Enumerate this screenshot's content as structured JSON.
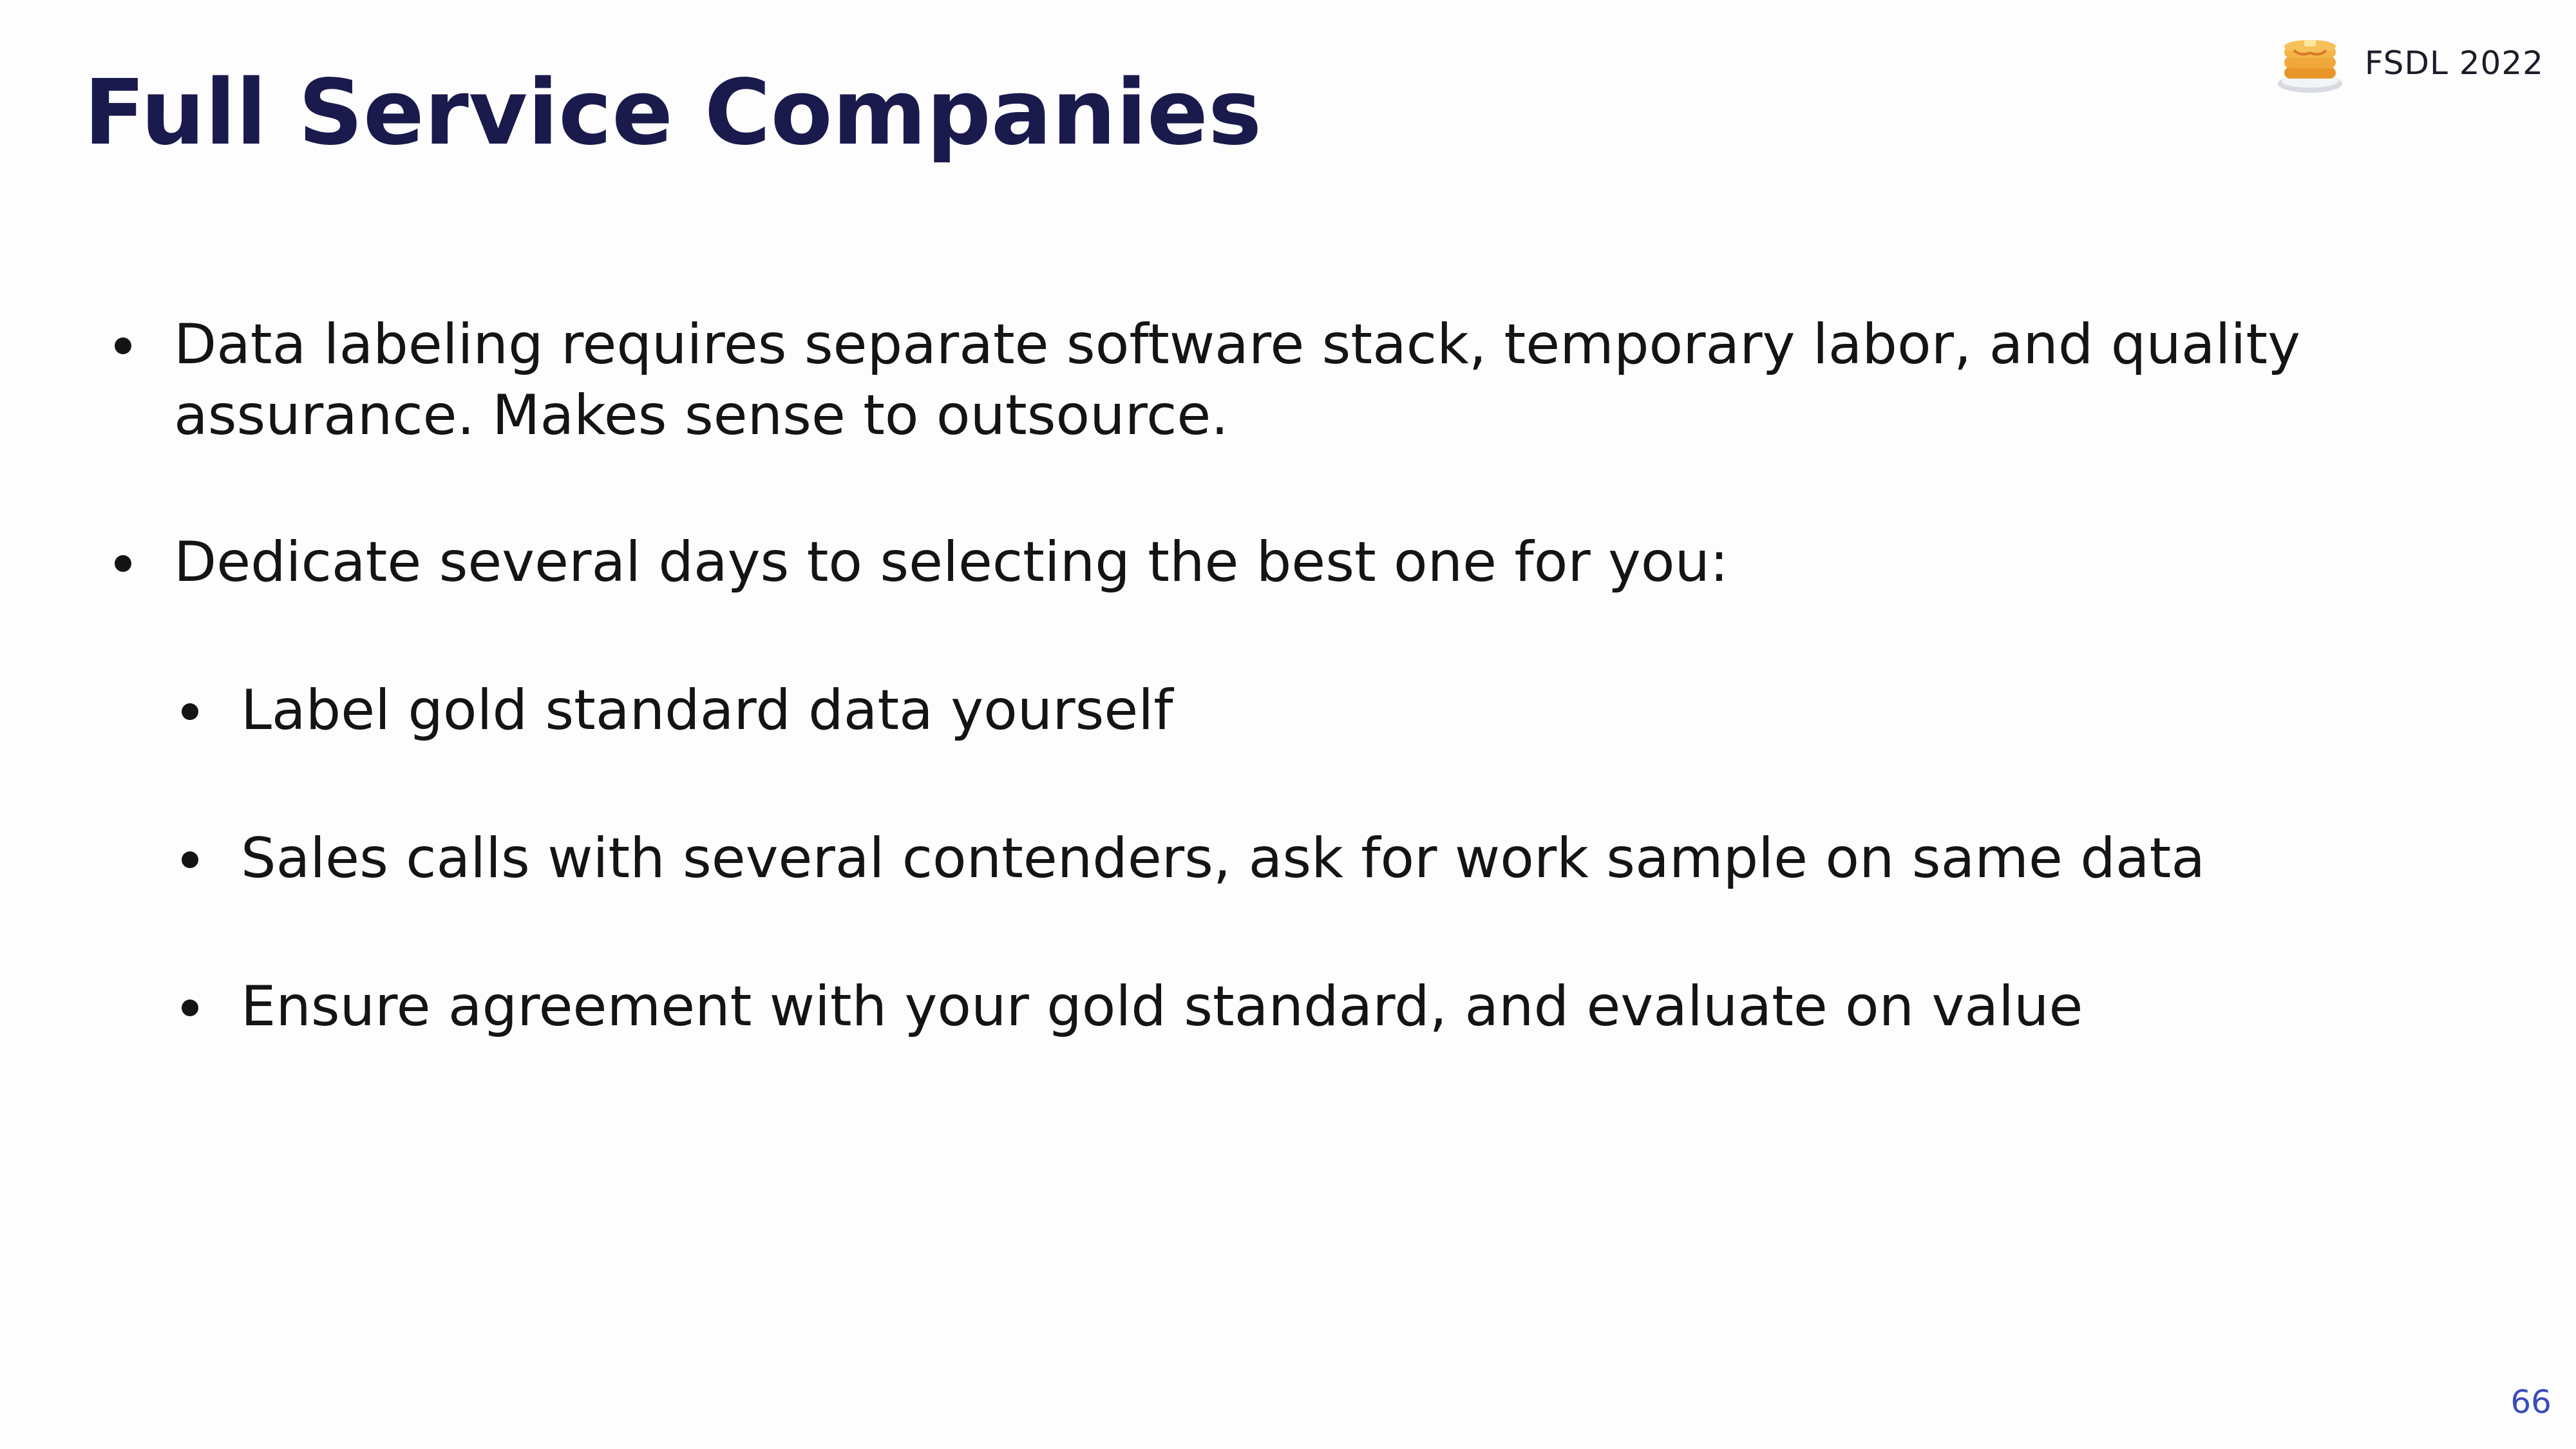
{
  "slide": {
    "title": "Full Service Companies",
    "brand": {
      "logo_icon": "pancake-stack-icon",
      "label": "FSDL 2022"
    },
    "bullets": [
      {
        "text": "Data labeling requires separate software stack, temporary labor, and quality assurance. Makes sense to outsource."
      },
      {
        "text": "Dedicate several days to selecting the best one for you:",
        "sub_bullets": [
          "Label gold standard data yourself",
          "Sales calls with several contenders, ask for work sample on same data",
          "Ensure agreement with your gold standard, and evaluate on value"
        ]
      }
    ],
    "page_number": "66"
  },
  "colors": {
    "title": "#1b1a4d",
    "body_text": "#141414",
    "page_number": "#3b4bb8",
    "background": "#fdfdfd"
  }
}
